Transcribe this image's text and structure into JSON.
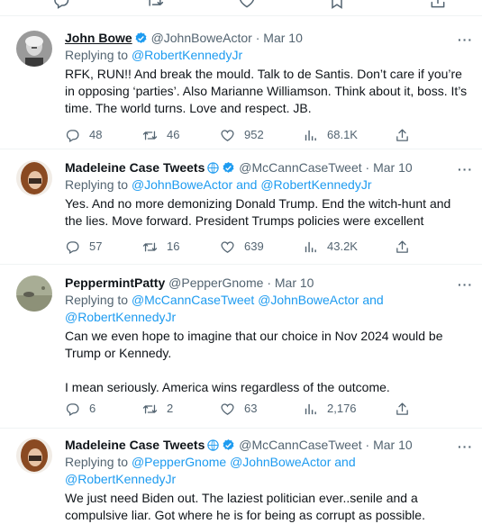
{
  "tweets": [
    {
      "name": "John Bowe",
      "verified": true,
      "globe": false,
      "handle": "@JohnBoweActor",
      "date": "Mar 10",
      "reply_prefix": "Replying to ",
      "reply_to": "@RobertKennedyJr",
      "body": "RFK, RUN!! And break the mould. Talk to de Santis. Don’t care if you’re in opposing ‘parties’. Also Marianne Williamson. Think about it, boss. It’s time. The world turns. Love and respect. JB.",
      "replies": "48",
      "retweets": "46",
      "likes": "952",
      "views": "68.1K"
    },
    {
      "name": "Madeleine Case Tweets",
      "verified": true,
      "globe": true,
      "handle": "@McCannCaseTweet",
      "date": "Mar 10",
      "reply_prefix": "Replying to ",
      "reply_to": "@JohnBoweActor and @RobertKennedyJr",
      "body": "Yes. And no more demonizing Donald Trump. End the witch-hunt and the lies. Move forward. President Trumps policies were excellent",
      "replies": "57",
      "retweets": "16",
      "likes": "639",
      "views": "43.2K"
    },
    {
      "name": "PeppermintPatty",
      "verified": false,
      "globe": false,
      "handle": "@PepperGnome",
      "date": "Mar 10",
      "reply_prefix": "Replying to ",
      "reply_to": "@McCannCaseTweet @JohnBoweActor and @RobertKennedyJr",
      "body": "Can we even hope to imagine that our choice in Nov 2024 would be Trump or Kennedy.",
      "body2": "I mean seriously. America wins regardless of the outcome.",
      "replies": "6",
      "retweets": "2",
      "likes": "63",
      "views": "2,176"
    },
    {
      "name": "Madeleine Case Tweets",
      "verified": true,
      "globe": true,
      "handle": "@McCannCaseTweet",
      "date": "Mar 10",
      "reply_prefix": "Replying to ",
      "reply_to": "@PepperGnome @JohnBoweActor and @RobertKennedyJr",
      "body": "We just need Biden out. The laziest politician ever..senile and a compulsive liar. Got where he is for being as corrupt as possible."
    }
  ],
  "colors": {
    "accent": "#1d9bf0",
    "muted": "#536471",
    "text": "#0f1419",
    "border": "#eff3f4"
  },
  "icons": [
    "reply-icon",
    "retweet-icon",
    "like-icon",
    "views-icon",
    "share-icon",
    "more-icon",
    "verified-icon",
    "globe-icon",
    "bookmark-icon"
  ]
}
